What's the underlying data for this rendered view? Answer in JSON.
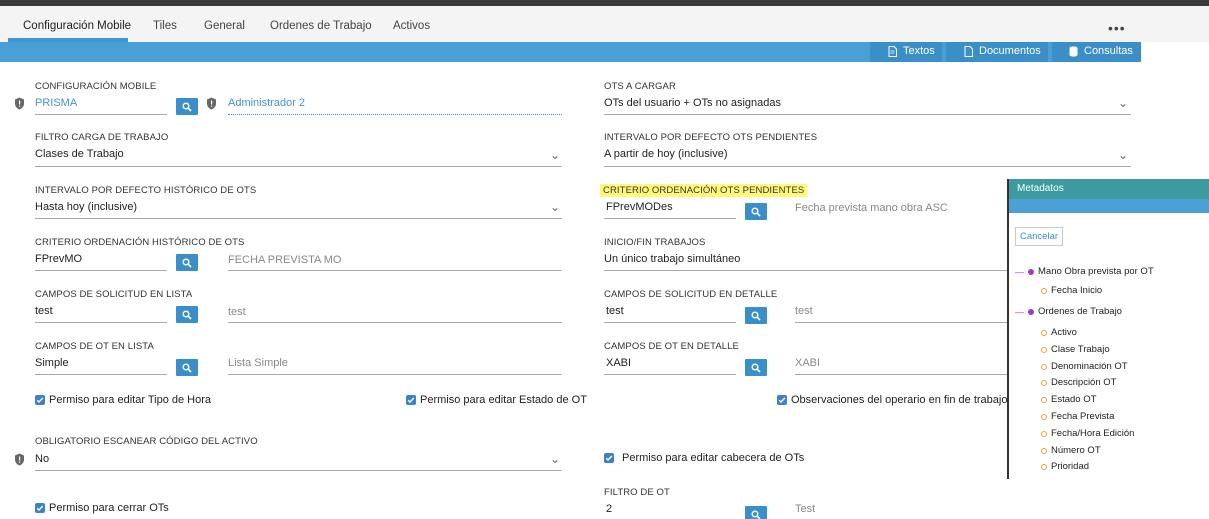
{
  "tabs": [
    "Configuración Mobile",
    "Tiles",
    "General",
    "Ordenes de Trabajo",
    "Activos"
  ],
  "more_icon": "•••",
  "toolbar": {
    "textos": "Textos",
    "documentos": "Documentos",
    "consultas": "Consultas"
  },
  "left": {
    "config_mobile": {
      "label": "CONFIGURACIÓN MOBILE",
      "value": "PRISMA",
      "desc": "Administrador 2"
    },
    "filtro_carga": {
      "label": "FILTRO CARGA DE TRABAJO",
      "value": "Clases de Trabajo"
    },
    "intervalo_hist": {
      "label": "INTERVALO POR DEFECTO HISTÓRICO DE OTS",
      "value": "Hasta hoy (inclusive)"
    },
    "criterio_hist": {
      "label": "CRITERIO ORDENACIÓN HISTÓRICO DE OTS",
      "value": "FPrevMO",
      "desc": "FECHA PREVISTA MO"
    },
    "campos_sol_lista": {
      "label": "CAMPOS DE SOLICITUD EN LISTA",
      "value": "test",
      "desc": "test"
    },
    "campos_ot_lista": {
      "label": "CAMPOS DE OT EN LISTA",
      "value": "Simple",
      "desc": "Lista Simple"
    },
    "permiso_tipo_hora": "Permiso para editar Tipo de Hora",
    "permiso_estado_ot": "Permiso para editar Estado de OT",
    "obligatorio": {
      "label": "OBLIGATORIO ESCANEAR CÓDIGO DEL ACTIVO",
      "value": "No"
    },
    "permiso_cerrar": "Permiso para cerrar OTs"
  },
  "right": {
    "ots_cargar": {
      "label": "OTS A CARGAR",
      "value": "OTs del usuario + OTs no asignadas"
    },
    "intervalo_pend": {
      "label": "INTERVALO POR DEFECTO OTS PENDIENTES",
      "value": "A partir de hoy (inclusive)"
    },
    "criterio_pend": {
      "label": "CRITERIO ORDENACIÓN OTS PENDIENTES",
      "value": "FPrevMODes",
      "desc": "Fecha prevista mano obra ASC"
    },
    "inicio_fin": {
      "label": "INICIO/FIN TRABAJOS",
      "value": "Un único trabajo simultáneo"
    },
    "campos_sol_detalle": {
      "label": "CAMPOS DE SOLICITUD EN DETALLE",
      "value": "test",
      "desc": "test"
    },
    "campos_ot_detalle": {
      "label": "CAMPOS DE OT EN DETALLE",
      "value": "XABI",
      "desc": "XABI"
    },
    "observaciones": "Observaciones del operario en fin de trabajo",
    "permiso_cabecera": "Permiso para editar cabecera de OTs",
    "filtro_ot": {
      "label": "FILTRO DE OT",
      "value": "2",
      "desc": "Test"
    }
  },
  "metadatos": {
    "title": "Metadatos",
    "cancel": "Cancelar",
    "groups": [
      {
        "label": "Mano Obra prevista por OT",
        "items": [
          "Fecha Inicio"
        ]
      },
      {
        "label": "Ordenes de Trabajo",
        "items": [
          "Activo",
          "Clase Trabajo",
          "Denominación OT",
          "Descripción OT",
          "Estado OT",
          "Fecha Prevista",
          "Fecha/Hora Edición",
          "Número OT",
          "Prioridad"
        ]
      }
    ]
  },
  "colors": {
    "accent": "#4aa0d5",
    "button": "#3b8fc8",
    "checkbox": "#3b82c8",
    "highlight": "#fff97a",
    "meta_header": "#3d9ba0",
    "tree_dot": "#9b3bc9",
    "tree_leaf": "#e6a23c"
  }
}
